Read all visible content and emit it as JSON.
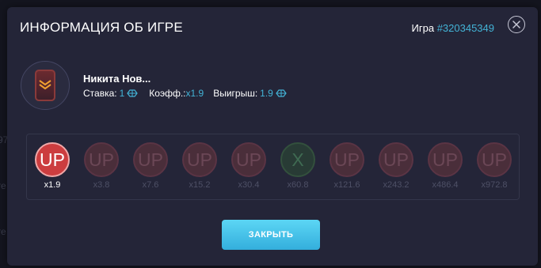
{
  "background_fragments": [
    "97",
    "re",
    "re"
  ],
  "modal": {
    "title": "ИНФОРМАЦИЯ ОБ ИГРЕ",
    "game_label": "Игра",
    "game_number": "#320345349"
  },
  "player": {
    "name": "Никита Нов...",
    "bet_label": "Ставка:",
    "bet_value": "1",
    "coef_label": "Коэфф.:",
    "coef_value": "x1.9",
    "win_label": "Выигрыш:",
    "win_value": "1.9"
  },
  "rounds": [
    {
      "symbol": "UP",
      "multiplier": "x1.9",
      "state": "up-on"
    },
    {
      "symbol": "UP",
      "multiplier": "x3.8",
      "state": "up-off"
    },
    {
      "symbol": "UP",
      "multiplier": "x7.6",
      "state": "up-off"
    },
    {
      "symbol": "UP",
      "multiplier": "x15.2",
      "state": "up-off"
    },
    {
      "symbol": "UP",
      "multiplier": "x30.4",
      "state": "up-off"
    },
    {
      "symbol": "X",
      "multiplier": "x60.8",
      "state": "x-off"
    },
    {
      "symbol": "UP",
      "multiplier": "x121.6",
      "state": "up-off"
    },
    {
      "symbol": "UP",
      "multiplier": "x243.2",
      "state": "up-off"
    },
    {
      "symbol": "UP",
      "multiplier": "x486.4",
      "state": "up-off"
    },
    {
      "symbol": "UP",
      "multiplier": "x972.8",
      "state": "up-off"
    }
  ],
  "close_button": "ЗАКРЫТЬ",
  "colors": {
    "accent": "#43b3d6",
    "button": "#4cc6ec",
    "up_active": "#cc3d3f",
    "modal_bg": "#242538"
  },
  "icons": {
    "close": "close-icon",
    "coin": "coin-icon",
    "avatar": "rank-chevron-icon"
  }
}
